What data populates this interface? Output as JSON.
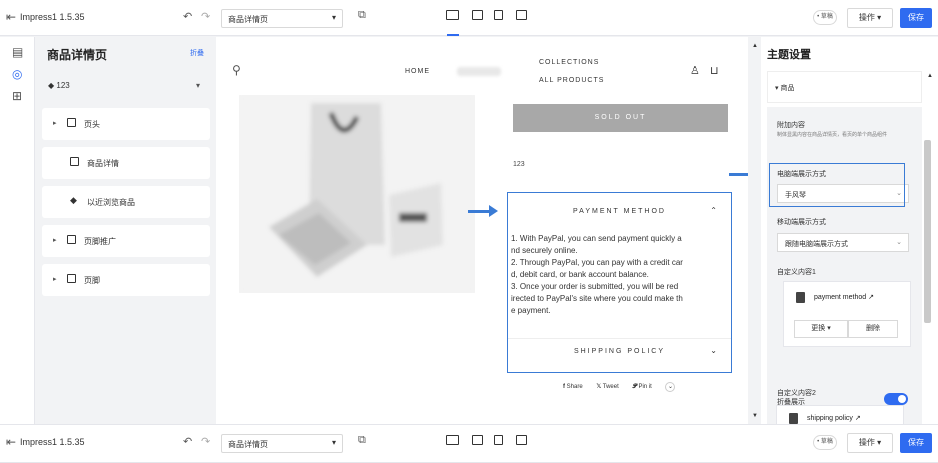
{
  "topbar": {
    "version": "Impress1 1.5.35",
    "page_select": "商品详情页",
    "badge": "• 草稿",
    "ops_label": "操作 ▾",
    "save_label": "保存"
  },
  "left_panel": {
    "title": "商品详情页",
    "collapse": "折叠",
    "tag_select": "123",
    "items": [
      {
        "label": "页头",
        "has_arrow": true
      },
      {
        "label": "商品详情",
        "has_arrow": false
      },
      {
        "label": "以近浏览商品",
        "has_arrow": false
      },
      {
        "label": "页脚推广",
        "has_arrow": true
      },
      {
        "label": "页脚",
        "has_arrow": true
      }
    ]
  },
  "canvas": {
    "nav_home": "HOME",
    "nav_collections": "COLLECTIONS",
    "nav_all_products": "ALL PRODUCTS",
    "sold_out": "SOLD OUT",
    "product_number": "123",
    "payment_heading": "PAYMENT METHOD",
    "payment_lines": [
      "1. With PayPal, you can send payment quickly a",
      "nd securely online.",
      "2. Through PayPal, you can pay with a credit car",
      "d, debit card, or bank account balance.",
      "3. Once your order is submitted, you will be red",
      "irected to PayPal's site where you could make th",
      "e payment."
    ],
    "shipping_heading": "SHIPPING POLICY",
    "share": "Share",
    "tweet": "Tweet",
    "pin": "Pin it"
  },
  "right_panel": {
    "title": "主题设置",
    "section": "▾ 商品",
    "extra_content_label": "附加内容",
    "extra_content_desc": "制体显黑内容在商品详情页，看页的单个商品组件",
    "pc_display_label": "电脑端展示方式",
    "pc_display_value": "手风琴",
    "mobile_display_label": "移动端展示方式",
    "mobile_display_value": "跟随电脑端展示方式",
    "custom1_label": "自定义内容1",
    "custom1_name": "payment method",
    "replace_label": "更换 ▾",
    "delete_label": "删除",
    "collapse_display_label": "折叠展示",
    "custom2_label": "自定义内容2",
    "custom2_name": "shipping policy"
  },
  "colors": {
    "accent": "#2f6bf0",
    "highlight": "#3a7bd5"
  }
}
